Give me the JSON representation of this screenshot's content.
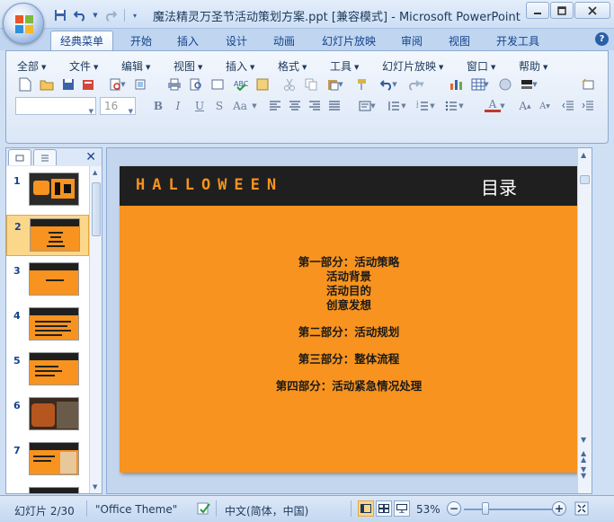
{
  "window": {
    "title": "魔法精灵万圣节活动策划方案.ppt [兼容模式] - Microsoft PowerPoint",
    "controls": [
      "minimize",
      "maximize",
      "close"
    ]
  },
  "ribbon_tabs": [
    "经典菜单",
    "开始",
    "插入",
    "设计",
    "动画",
    "幻灯片放映",
    "审阅",
    "视图",
    "开发工具"
  ],
  "active_tab": "经典菜单",
  "classic_menu": [
    "全部",
    "文件",
    "编辑",
    "视图",
    "插入",
    "格式",
    "工具",
    "幻灯片放映",
    "窗口",
    "帮助"
  ],
  "font": {
    "name": "",
    "size": "16"
  },
  "thumbnails": {
    "numbers": [
      "1",
      "2",
      "3",
      "4",
      "5",
      "6",
      "7"
    ],
    "selected": "2"
  },
  "slide": {
    "header_word": "HALLOWEEN",
    "title": "目录",
    "lines": [
      "第一部分：活动策略",
      "活动背景",
      "活动目的",
      "创意发想",
      "第二部分：活动规划",
      "第三部分：整体流程",
      "第四部分：活动紧急情况处理"
    ],
    "colors": {
      "background": "#f7931e",
      "header": "#1f1f1f"
    }
  },
  "status": {
    "slide_counter": "幻灯片 2/30",
    "theme": "\"Office Theme\"",
    "language": "中文(简体，中国)",
    "zoom": "53%"
  }
}
